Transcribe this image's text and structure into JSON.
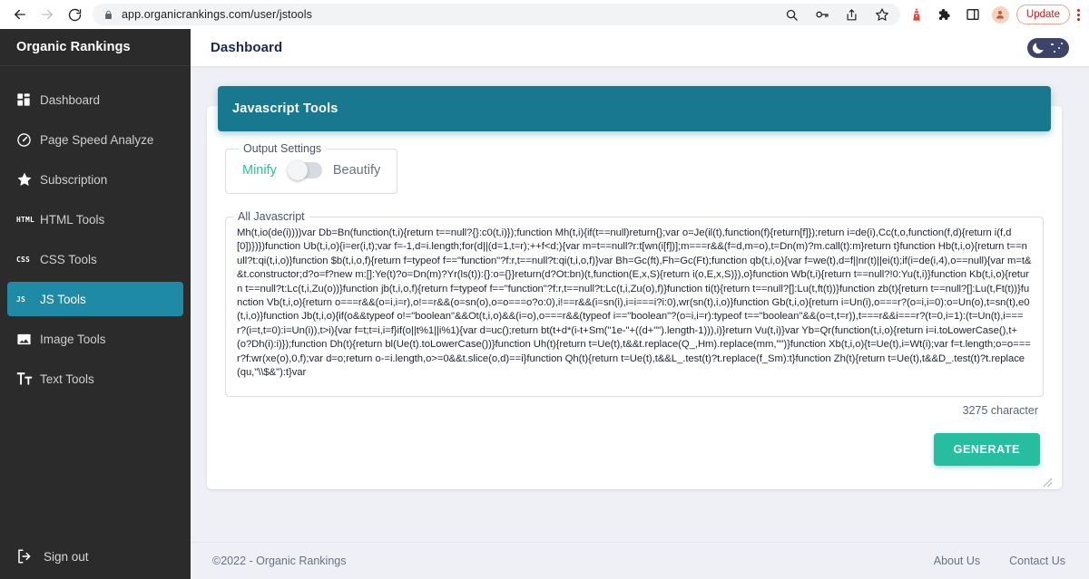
{
  "browser": {
    "back_icon": "arrow-left-icon",
    "forward_icon": "arrow-right-icon",
    "reload_icon": "reload-icon",
    "lock_icon": "lock-icon",
    "url": "app.organicrankings.com/user/jstools",
    "omni_search_icon": "search-icon",
    "omni_key_icon": "key-icon",
    "share_icon": "share-icon",
    "bookmark_icon": "star-icon",
    "extension_alert_icon": "lighthouse-icon",
    "extensions_icon": "puzzle-piece-icon",
    "sidepanel_icon": "side-panel-icon",
    "profile_icon": "avatar-icon",
    "update_label": "Update",
    "menu_icon": "kebab-menu-icon"
  },
  "sidebar": {
    "brand": "Organic Rankings",
    "items": [
      {
        "label": "Dashboard",
        "icon": "grid-icon",
        "active": false
      },
      {
        "label": "Page Speed Analyze",
        "icon": "speedometer-icon",
        "active": false
      },
      {
        "label": "Subscription",
        "icon": "star-icon",
        "active": false
      },
      {
        "label": "HTML Tools",
        "icon": "html-icon",
        "active": false
      },
      {
        "label": "CSS Tools",
        "icon": "css-icon",
        "active": false
      },
      {
        "label": "JS Tools",
        "icon": "js-icon",
        "active": true
      },
      {
        "label": "Image Tools",
        "icon": "image-icon",
        "active": false
      },
      {
        "label": "Text Tools",
        "icon": "text-format-icon",
        "active": false
      }
    ],
    "signout": {
      "label": "Sign out",
      "icon": "logout-icon"
    }
  },
  "topbar": {
    "title": "Dashboard",
    "dark_mode_toggle": "moon-icon"
  },
  "card": {
    "title": "Javascript Tools",
    "header_color": "#17788f",
    "output_settings": {
      "legend": "Output Settings",
      "minify_label": "Minify",
      "beautify_label": "Beautify",
      "minify_color": "#2fbf9b",
      "beautify_color": "#6b7280",
      "toggle_state": "off"
    },
    "javascript": {
      "legend": "All Javascript",
      "value": "Mh(t,io(de(i))))var Db=Bn(function(t,i){return t==null?{}:c0(t,i)});function Mh(t,i){if(t==null)return{};var o=Je(il(t),function(f){return[f]});return i=de(i),Cc(t,o,function(f,d){return i(f,d[0])})})function Ub(t,i,o){i=er(i,t);var f=-1,d=i.length;for(d||(d=1,t=r);++f<d;){var m=t==null?r:t[wn(i[f])];m===r&&(f=d,m=o),t=Dn(m)?m.call(t):m}return t}function Hb(t,i,o){return t==null?t:qi(t,i,o)}function $b(t,i,o,f){return f=typeof f==\"function\"?f:r,t==null?t:qi(t,i,o,f)}var Bh=Gc(ft),Fh=Gc(Ft);function qb(t,i,o){var f=we(t),d=f||nr(t)||ei(t);if(i=de(i,4),o==null){var m=t&&t.constructor;d?o=f?new m:[]:Ye(t)?o=Dn(m)?Yr(ls(t)):{}:o={}}return(d?Ot:bn)(t,function(E,x,S){return i(o,E,x,S)}),o}function Wb(t,i){return t==null?!0:Yu(t,i)}function Kb(t,i,o){return t==null?t:Lc(t,i,Zu(o))}function jb(t,i,o,f){return f=typeof f==\"function\"?f:r,t==null?t:Lc(t,i,Zu(o),f)}function ti(t){return t==null?[]:Lu(t,ft(t))}function zb(t){return t==null?[]:Lu(t,Ft(t))}function Vb(t,i,o){return o===r&&(o=i,i=r),o!==r&&(o=sn(o),o=o===o?o:0),i!==r&&(i=sn(i),i=i===i?i:0),wr(sn(t),i,o)}function Gb(t,i,o){return i=Un(i),o===r?(o=i,i=0):o=Un(o),t=sn(t),e0(t,i,o)}function Jb(t,i,o){if(o&&typeof o!=\"boolean\"&&Ot(t,i,o)&&(i=o),o===r&&(typeof i==\"boolean\"?(o=i,i=r):typeof t==\"boolean\"&&(o=t,t=r)),t===r&&i===r?(t=0,i=1):(t=Un(t),i===r?(i=t,t=0):i=Un(i)),t>i){var f=t;t=i,i=f}if(o||t%1||i%1){var d=uc();return bt(t+d*(i-t+Sm(\"1e-\"+((d+\"\").length-1))),i)}return Vu(t,i)}var Yb=Qr(function(t,i,o){return i=i.toLowerCase(),t+(o?Dh(i):i)});function Dh(t){return bl(Ue(t).toLowerCase())}function Uh(t){return t=Ue(t),t&&t.replace(Q_,Hm).replace(mm,\"\")}function Xb(t,i,o){t=Ue(t),i=Wt(i);var f=t.length;o=o===r?f:wr(xe(o),0,f);var d=o;return o-=i.length,o>=0&&t.slice(o,d)==i}function Qh(t){return t=Ue(t),t&&L_.test(t)?t.replace(f_Sm):t}function Zh(t){return t=Ue(t),t&&D_.test(t)?t.replace(qu,\"\\\\$&\"):t}var",
      "char_count": "3275 character"
    },
    "generate_button": "GENERATE"
  },
  "footer": {
    "copyright": "©2022 - Organic Rankings",
    "links": [
      "About Us",
      "Contact Us"
    ]
  }
}
